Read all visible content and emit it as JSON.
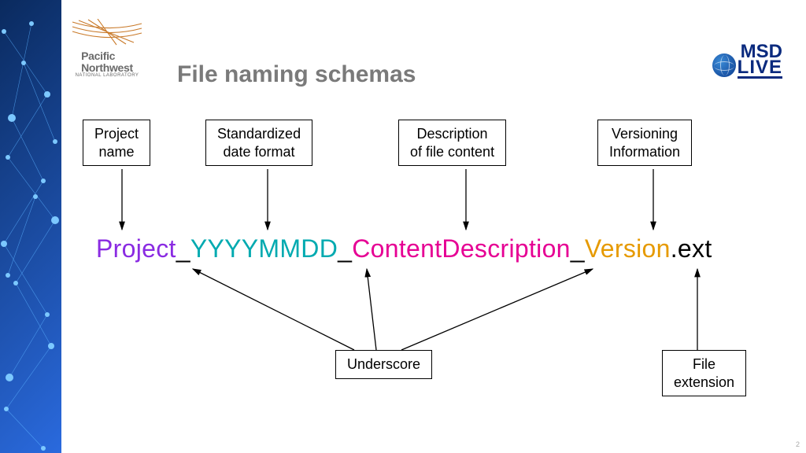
{
  "header": {
    "title": "File naming schemas",
    "pnnl_line1": "Pacific",
    "pnnl_line2": "Northwest",
    "pnnl_sub": "NATIONAL LABORATORY",
    "msd_top": "MSD",
    "msd_bot": "LIVE"
  },
  "boxes": {
    "project": "Project\nname",
    "date": "Standardized\ndate format",
    "desc": "Description\nof file content",
    "version": "Versioning\nInformation",
    "underscore": "Underscore",
    "ext": "File\nextension"
  },
  "filename": {
    "project": "Project",
    "u": "_",
    "date": "YYYYMMDD",
    "content": "ContentDescription",
    "version": "Version",
    "ext": ".ext"
  },
  "page_number": "2"
}
